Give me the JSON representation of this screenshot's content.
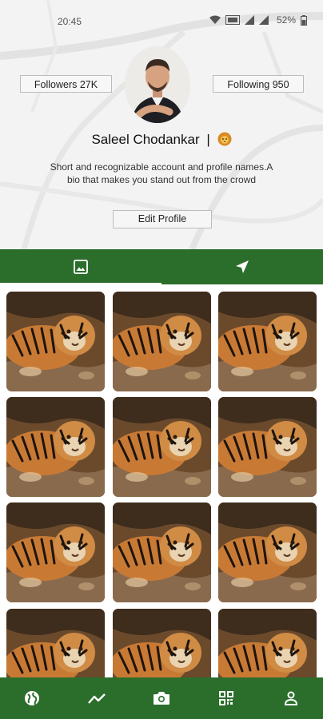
{
  "status_bar": {
    "time": "20:45",
    "battery_percent": "52%",
    "icons": [
      "wifi-icon",
      "volte-icon",
      "signal-icon",
      "signal-icon",
      "battery-icon"
    ]
  },
  "profile": {
    "name": "Saleel Chodankar",
    "separator": "|",
    "badge_icon": "lion-icon",
    "followers_label": "Followers 27K",
    "following_label": "Following 950",
    "bio": "Short and recognizable account and profile names.A bio that makes you stand out from the crowd",
    "edit_button": "Edit Profile"
  },
  "tabs": [
    {
      "icon": "image-icon",
      "active": true
    },
    {
      "icon": "navigation-arrow-icon",
      "active": false
    }
  ],
  "grid": {
    "image": "tiger-photo",
    "columns": 3,
    "visible_rows": 4
  },
  "bottom_nav": [
    {
      "icon": "globe-icon"
    },
    {
      "icon": "trending-icon"
    },
    {
      "icon": "camera-icon"
    },
    {
      "icon": "qr-code-icon"
    },
    {
      "icon": "person-icon"
    }
  ],
  "colors": {
    "primary_green": "#2b6e2b",
    "header_background": "#f3f3f3"
  }
}
